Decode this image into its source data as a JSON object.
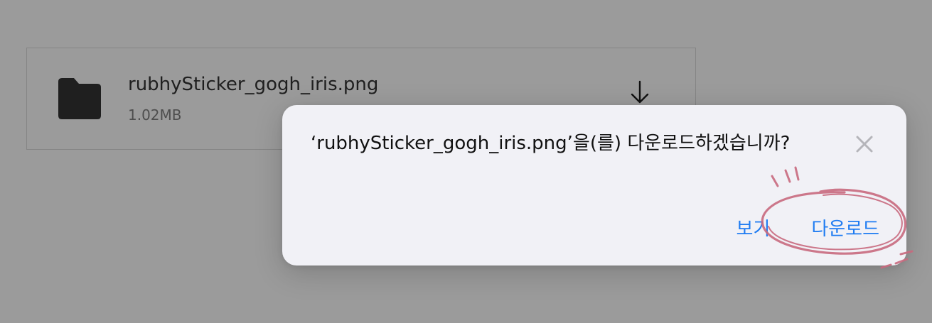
{
  "file": {
    "name": "rubhySticker_gogh_iris.png",
    "size": "1.02MB",
    "icon": "folder-icon",
    "action_icon": "download-arrow-icon"
  },
  "dialog": {
    "message": "‘rubhySticker_gogh_iris.png’을(를) 다운로드하겠습니까?",
    "close_icon": "close-icon",
    "buttons": {
      "view": "보기",
      "download": "다운로드"
    }
  },
  "colors": {
    "backdrop": "#9b9b9b",
    "dialog_background": "#f1f1f6",
    "accent": "#1f7cf2",
    "annotation": "#c86a7f"
  }
}
